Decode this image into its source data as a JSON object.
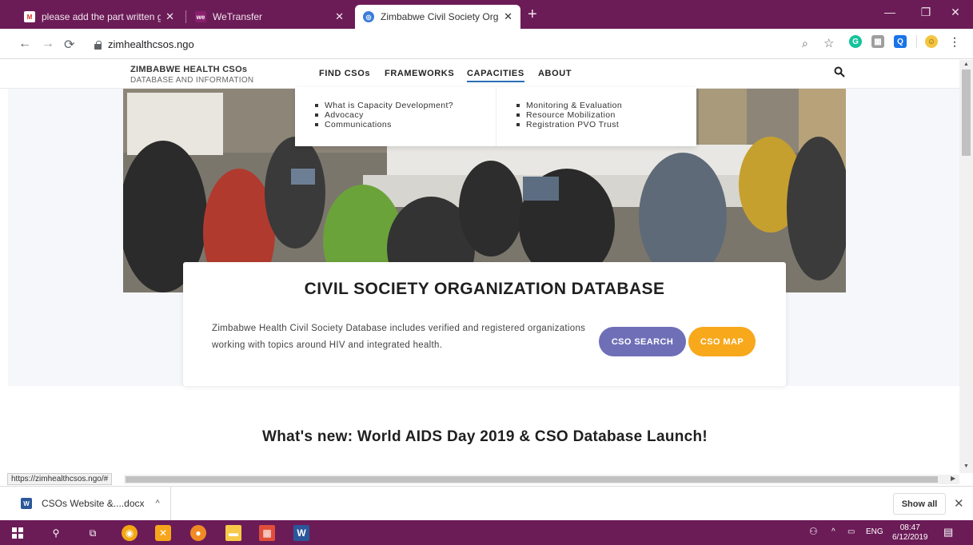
{
  "browser": {
    "tabs": [
      {
        "title": "please add the part written glob:",
        "active": false
      },
      {
        "title": "WeTransfer",
        "active": false
      },
      {
        "title": "Zimbabwe Civil Society Organiza",
        "active": true
      }
    ],
    "url": "zimhealthcsos.ngo",
    "icons": [
      "back-icon",
      "forward-icon",
      "reload-icon",
      "lock-icon",
      "zoom-icon",
      "star-icon",
      "grammarly-icon",
      "extension-icon",
      "search-extension-icon",
      "profile-icon",
      "menu-icon"
    ]
  },
  "site": {
    "brand_line1": "ZIMBABWE HEALTH CSOs",
    "brand_line2": "DATABASE AND INFORMATION",
    "nav": [
      {
        "label": "FIND CSOs",
        "active": false
      },
      {
        "label": "FRAMEWORKS",
        "active": false
      },
      {
        "label": "CAPACITIES",
        "active": true
      },
      {
        "label": "ABOUT",
        "active": false
      }
    ],
    "dropdown": {
      "left": [
        "What is Capacity Development?",
        "Advocacy",
        "Communications"
      ],
      "right": [
        "Monitoring & Evaluation",
        "Resource Mobilization",
        "Registration PVO Trust"
      ]
    },
    "hero": {
      "title": "CIVIL SOCIETY ORGANIZATION DATABASE",
      "description": "Zimbabwe Health Civil Society Database includes verified and registered organizations working with topics around HIV and integrated health.",
      "search_button": "CSO SEARCH",
      "map_button": "CSO MAP",
      "colors": {
        "search": "#6f6fb8",
        "map": "#f7a81b"
      }
    },
    "whats_new": "What's new: World AIDS Day 2019 & CSO Database Launch!"
  },
  "status_url": "https://zimhealthcsos.ngo/#",
  "downloads": {
    "file": "CSOs Website &....docx",
    "show_all": "Show all"
  },
  "taskbar": {
    "lang": "ENG",
    "time": "08:47",
    "date": "6/12/2019",
    "accent": "#6b1c57"
  }
}
